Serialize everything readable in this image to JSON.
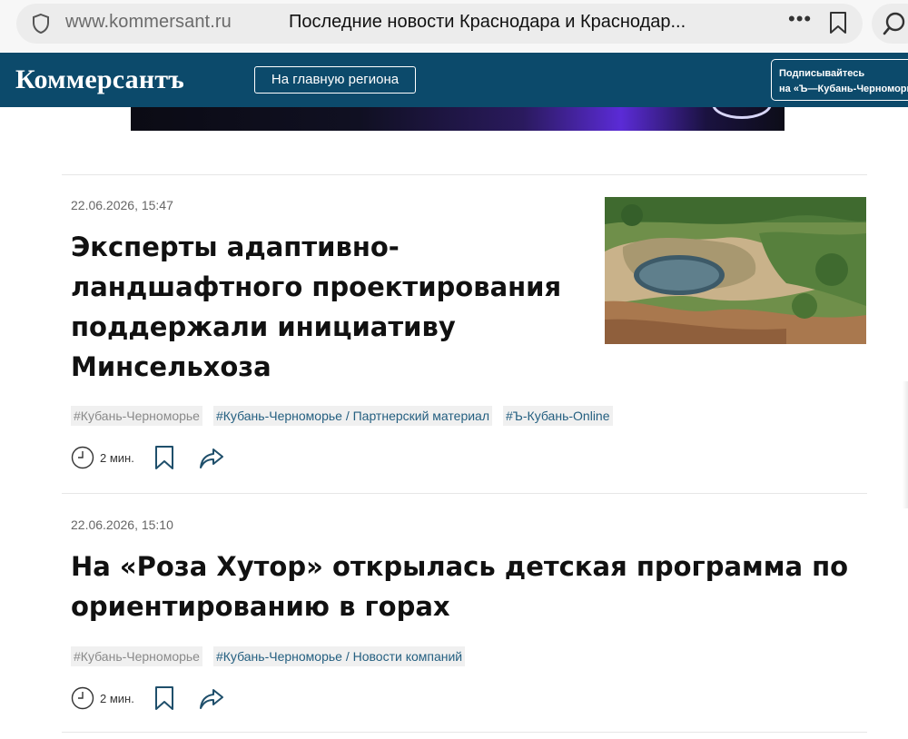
{
  "browser": {
    "domain": "www.kommersant.ru",
    "title": "Последние новости Краснодара и Краснодар...",
    "more": "•••"
  },
  "header": {
    "logo": "Коммерсантъ",
    "region_button": "На главную региона",
    "subscribe_line1": "Подписывайтесь",
    "subscribe_line2": "на «Ъ—Кубань-Черноморье»"
  },
  "articles": [
    {
      "date": "22.06.2026, 15:47",
      "headline_lines": [
        "Эксперты адаптивно-",
        "ландшафтного проектирования",
        "поддержали инициативу",
        "Минсельхоза"
      ],
      "tags": [
        "#Кубань-Черноморье",
        "#Кубань-Черноморье / Партнерский материал",
        "#Ъ-Кубань-Online"
      ],
      "read_time": "2 мин."
    },
    {
      "date": "22.06.2026, 15:10",
      "headline_lines": [
        "На «Роза Хутор» открылась детская программа по",
        "ориентированию в горах"
      ],
      "tags": [
        "#Кубань-Черноморье",
        "#Кубань-Черноморье / Новости компаний"
      ],
      "read_time": "2 мин."
    }
  ],
  "colors": {
    "header_bg": "#0c4a6b",
    "tag_link": "#245f80",
    "tag_grey": "#8a8a8a"
  }
}
